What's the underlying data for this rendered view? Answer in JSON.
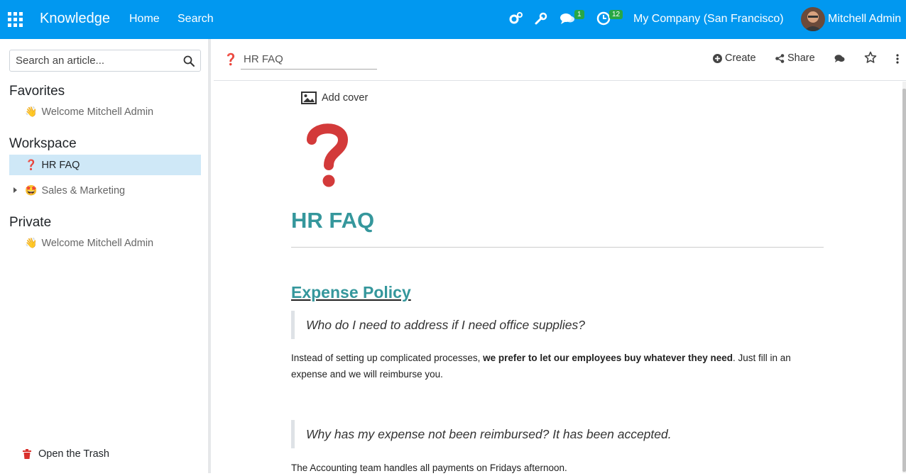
{
  "navbar": {
    "brand": "Knowledge",
    "menu": [
      "Home",
      "Search"
    ],
    "chat_badge": "1",
    "activity_badge": "12",
    "company": "My Company (San Francisco)",
    "user": "Mitchell Admin",
    "bg_color": "#0198f0"
  },
  "sidebar": {
    "search_placeholder": "Search an article...",
    "favorites_title": "Favorites",
    "favorites": [
      {
        "emoji": "👋",
        "label": "Welcome Mitchell Admin"
      }
    ],
    "workspace_title": "Workspace",
    "workspace": [
      {
        "emoji": "❓",
        "label": "HR FAQ",
        "active": true
      },
      {
        "emoji": "🤩",
        "label": "Sales & Marketing",
        "active": false
      }
    ],
    "private_title": "Private",
    "private": [
      {
        "emoji": "👋",
        "label": "Welcome Mitchell Admin"
      }
    ],
    "trash_label": "Open the Trash"
  },
  "toolbar": {
    "article_icon": "❓",
    "article_name": "HR FAQ",
    "create_label": "Create",
    "share_label": "Share"
  },
  "article": {
    "add_cover": "Add cover",
    "title": "HR FAQ",
    "section_heading": "Expense Policy",
    "q1": "Who do I need to address if I need office supplies?",
    "a1_part1": "Instead of setting up complicated processes, ",
    "a1_bold": "we prefer to let our employees buy whatever they need",
    "a1_part2": ". Just fill in an expense and we will reimburse you.",
    "q2": "Why has my expense not been reimbursed? It has been accepted.",
    "a2": "The Accounting team handles all payments on Fridays afternoon.",
    "accent_color": "#35979c"
  }
}
